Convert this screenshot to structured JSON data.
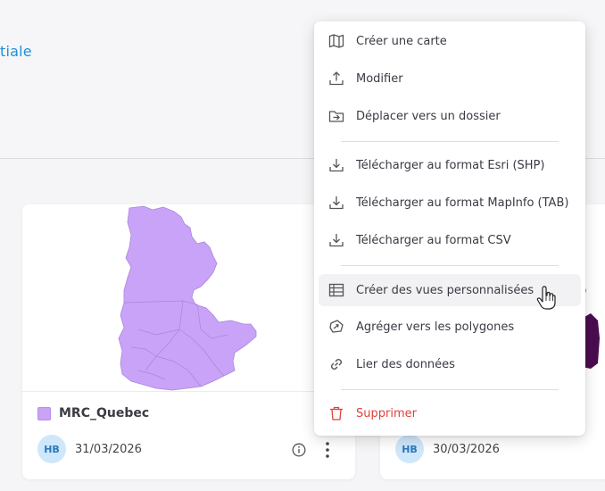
{
  "header": {
    "partial_title": "tiale"
  },
  "menu": {
    "items": [
      {
        "label": "Créer une carte",
        "icon": "map-icon"
      },
      {
        "label": "Modifier",
        "icon": "upload-icon"
      },
      {
        "label": "Déplacer vers un dossier",
        "icon": "folder-move-icon"
      },
      {
        "label": "Télécharger au format Esri (SHP)",
        "icon": "download-icon"
      },
      {
        "label": "Télécharger au format MapInfo (TAB)",
        "icon": "download-icon"
      },
      {
        "label": "Télécharger au format CSV",
        "icon": "download-icon"
      },
      {
        "label": "Créer des vues personnalisées",
        "icon": "table-icon"
      },
      {
        "label": "Agréger vers les polygones",
        "icon": "aggregate-icon"
      },
      {
        "label": "Lier des données",
        "icon": "link-icon"
      },
      {
        "label": "Supprimer",
        "icon": "trash-icon"
      }
    ]
  },
  "card_left": {
    "layer_name": "MRC_Quebec",
    "swatch_color": "#c9a3f7",
    "avatar": "HB",
    "date": "31/03/2026"
  },
  "card_right": {
    "avatar": "HB",
    "date": "30/03/2026",
    "map_color": "#4a0d4f"
  },
  "colors": {
    "accent": "#1f8fd6",
    "danger": "#e0413a"
  }
}
